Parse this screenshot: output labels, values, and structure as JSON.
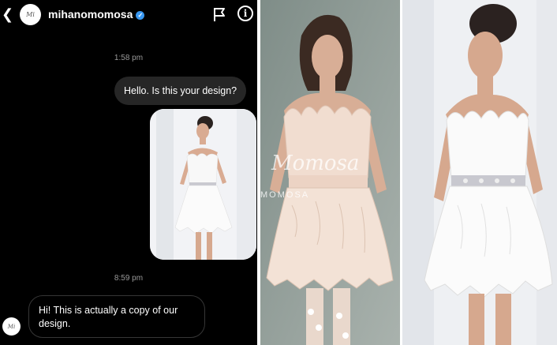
{
  "chat": {
    "header": {
      "back_icon": "chevron-left-icon",
      "avatar_text": "Mi",
      "username": "mihanomomosa",
      "verified_icon": "verified-badge-icon",
      "flag_icon": "flag-icon",
      "info_icon": "info-icon",
      "info_glyph": "i"
    },
    "timestamp_1": "1:58 pm",
    "outgoing_message": "Hello. Is this your design?",
    "timestamp_2": "8:59 pm",
    "incoming_message": "Hi! This is actually a copy of our design.",
    "colors": {
      "background": "#000000",
      "outgoing_bubble": "#262626",
      "verified": "#3897f0"
    }
  },
  "photo_a": {
    "watermark_script": "Momosa",
    "watermark_caps": "MOMOSA"
  }
}
